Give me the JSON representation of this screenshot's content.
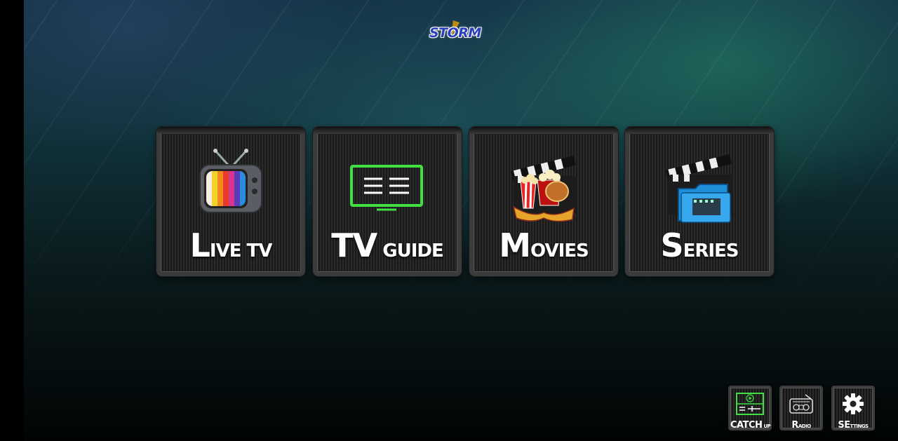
{
  "app": {
    "logo_text": "STORM"
  },
  "tiles": [
    {
      "big": "L",
      "small": "IVE",
      "big2": "",
      "small2": " TV",
      "icon": "retro-tv-icon"
    },
    {
      "big": "TV",
      "small": " GUIDE",
      "icon": "tv-guide-icon"
    },
    {
      "big": "M",
      "small": "OVIES",
      "icon": "movie-clapper-popcorn-icon"
    },
    {
      "big": "S",
      "small": "ERIES",
      "big2": "E",
      "icon": "clapper-folder-icon"
    }
  ],
  "small_tiles": [
    {
      "big": "C",
      "small": "ATCH",
      "small2": " UP",
      "icon": "catch-up-icon"
    },
    {
      "big": "R",
      "small": "ADIO",
      "icon": "radio-icon"
    },
    {
      "big": "SE",
      "small": "TTINGS",
      "icon": "gear-icon"
    }
  ],
  "colors": {
    "guide_green": "#3fe03f",
    "folder_blue": "#1e8fd8",
    "logo_blue": "#2a3fc0"
  }
}
